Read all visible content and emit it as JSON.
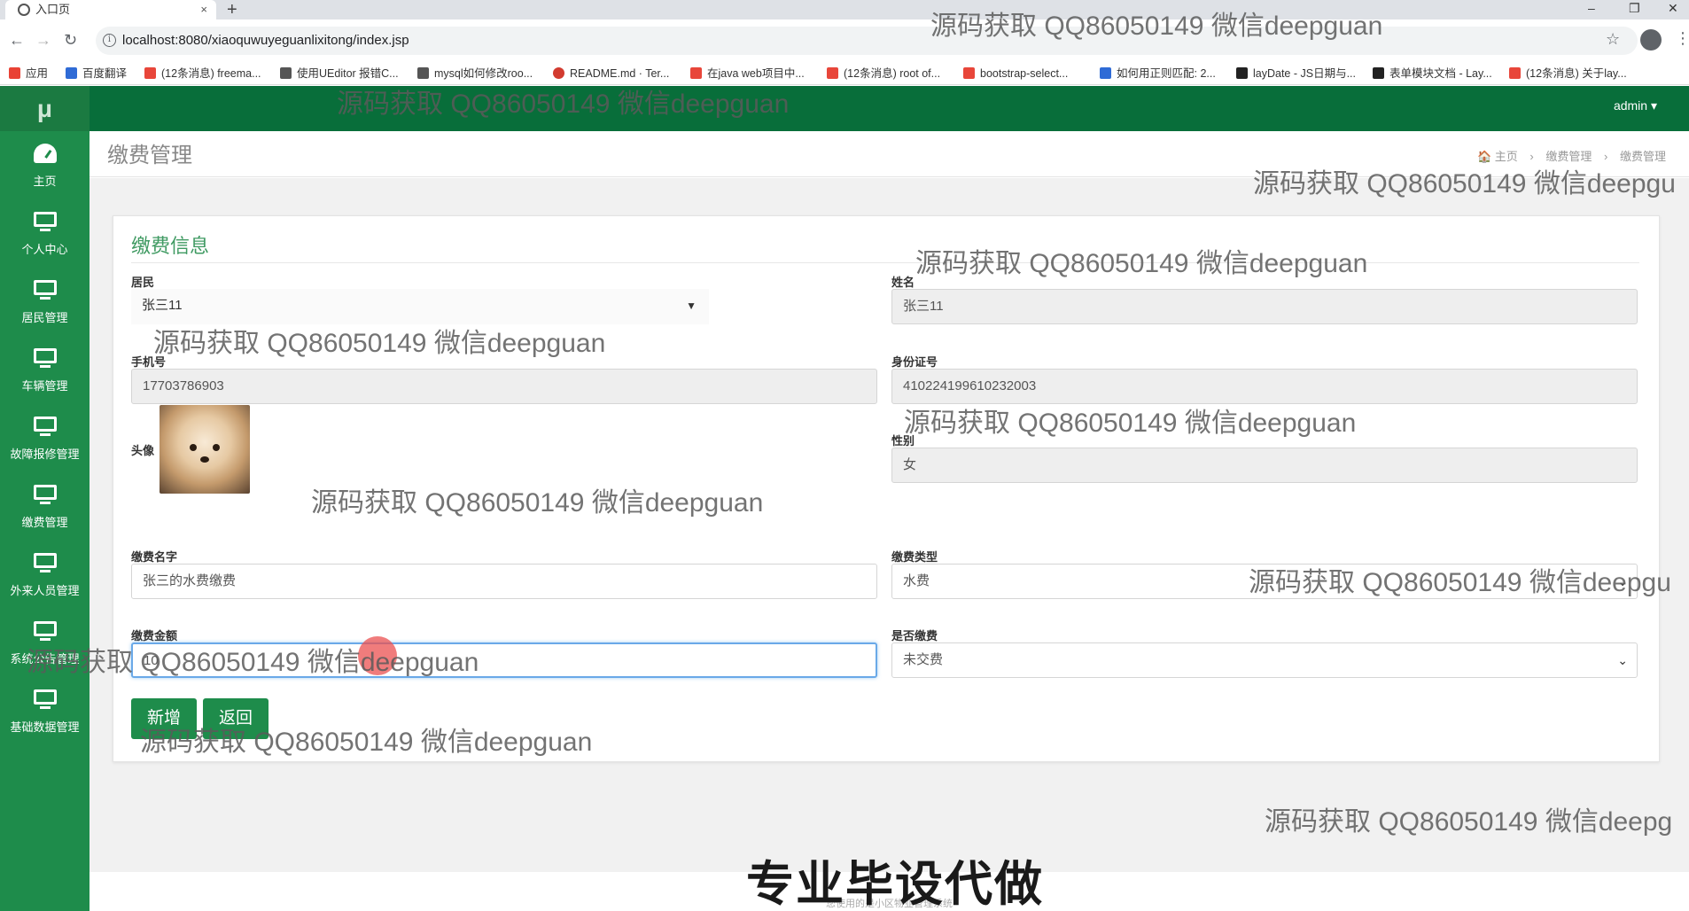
{
  "browser": {
    "tab_title": "入口页",
    "tab_close": "×",
    "new_tab": "+",
    "window_controls": [
      "–",
      "❐",
      "✕"
    ],
    "url": "localhost:8080/xiaoquwuyeguanlixitong/index.jsp",
    "bookmarks": [
      {
        "label": "应用",
        "color": "#e94235"
      },
      {
        "label": "百度翻译",
        "color": "#2f6bd6"
      },
      {
        "label": "(12条消息) freema...",
        "color": "#e8463a"
      },
      {
        "label": "使用UEditor 报错C...",
        "color": "#555555"
      },
      {
        "label": "mysql如何修改roo...",
        "color": "#555555"
      },
      {
        "label": "README.md · Ter...",
        "color": "#d23b2f"
      },
      {
        "label": "在java web项目中...",
        "color": "#e8463a"
      },
      {
        "label": "(12条消息) root of...",
        "color": "#e8463a"
      },
      {
        "label": "bootstrap-select...",
        "color": "#e8463a"
      },
      {
        "label": "如何用正则匹配: 2...",
        "color": "#2f6bd6"
      },
      {
        "label": "layDate - JS日期与...",
        "color": "#222222"
      },
      {
        "label": "表单模块文档 - Lay...",
        "color": "#222222"
      },
      {
        "label": "(12条消息) 关于lay...",
        "color": "#e8463a"
      }
    ]
  },
  "app": {
    "logo": "μ",
    "user": "admin ▾",
    "sidebar": [
      {
        "label": "主页",
        "icon": "dashboard-icon"
      },
      {
        "label": "个人中心",
        "icon": "monitor-icon"
      },
      {
        "label": "居民管理",
        "icon": "monitor-icon"
      },
      {
        "label": "车辆管理",
        "icon": "monitor-icon"
      },
      {
        "label": "故障报修管理",
        "icon": "monitor-icon"
      },
      {
        "label": "缴费管理",
        "icon": "monitor-icon"
      },
      {
        "label": "外来人员管理",
        "icon": "monitor-icon"
      },
      {
        "label": "系统公告管理",
        "icon": "monitor-icon"
      },
      {
        "label": "基础数据管理",
        "icon": "monitor-icon"
      }
    ],
    "page_title": "缴费管理",
    "breadcrumb": [
      "🏠 主页",
      "缴费管理",
      "缴费管理"
    ],
    "breadcrumb_sep": "›",
    "accent": "#1e8c4b"
  },
  "form": {
    "title": "缴费信息",
    "resident": {
      "label": "居民",
      "value": "张三11"
    },
    "name": {
      "label": "姓名",
      "value": "张三11"
    },
    "phone": {
      "label": "手机号",
      "value": "17703786903"
    },
    "id_number": {
      "label": "身份证号",
      "value": "410224199610232003"
    },
    "avatar": {
      "label": "头像"
    },
    "gender": {
      "label": "性别",
      "value": "女"
    },
    "fee_name": {
      "label": "缴费名字",
      "value": "张三的水费缴费"
    },
    "fee_type": {
      "label": "缴费类型",
      "value": "水费"
    },
    "amount": {
      "label": "缴费金额",
      "value": "10"
    },
    "paid": {
      "label": "是否缴费",
      "value": "未交费"
    },
    "buttons": {
      "add": "新增",
      "back": "返回"
    }
  },
  "footer": "您使用的是小区物业管理系统",
  "watermarks": [
    "源码获取 QQ86050149 微信deepguan",
    "源码获取 QQ86050149 微信deepguan",
    "源码获取 QQ86050149 微信deepgu",
    "源码获取 QQ86050149 微信deepguan",
    "源码获取 QQ86050149 微信deepguan",
    "源码获取 QQ86050149 微信deepguan",
    "源码获取 QQ86050149 微信deepguan",
    "源码获取 QQ86050149 微信deepgu",
    "源码获取 QQ86050149 微信deepguan",
    "源码获取 QQ86050149 微信deepguan",
    "源码获取 QQ86050149 微信deepg"
  ],
  "banner": "专业毕设代做"
}
